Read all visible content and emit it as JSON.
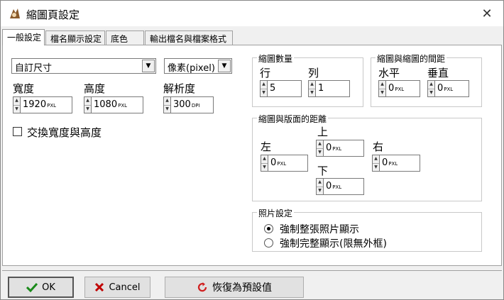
{
  "window": {
    "title": "縮圖頁設定",
    "close_label": "✕"
  },
  "tabs": [
    {
      "label": "一般設定",
      "active": true
    },
    {
      "label": "檔名顯示設定",
      "active": false
    },
    {
      "label": "底色",
      "active": false
    },
    {
      "label": "輸出檔名與檔案格式",
      "active": false
    }
  ],
  "size_preset": {
    "value": "自訂尺寸"
  },
  "unit_select": {
    "value": "像素(pixel)"
  },
  "width": {
    "label": "寬度",
    "value": "1920",
    "unit": "PXL"
  },
  "height": {
    "label": "高度",
    "value": "1080",
    "unit": "PXL"
  },
  "resolution": {
    "label": "解析度",
    "value": "300",
    "unit": "DPI"
  },
  "swap": {
    "label": "交換寬度與高度",
    "checked": false
  },
  "thumb_count": {
    "group_title": "縮圖數量",
    "rows": {
      "label": "行",
      "value": "5"
    },
    "cols": {
      "label": "列",
      "value": "1"
    }
  },
  "thumb_spacing": {
    "group_title": "縮圖與縮圖的間距",
    "horizontal": {
      "label": "水平",
      "value": "0",
      "unit": "PXL"
    },
    "vertical": {
      "label": "垂直",
      "value": "0",
      "unit": "PXL"
    }
  },
  "margin": {
    "group_title": "縮圖與版面的距離",
    "left": {
      "label": "左",
      "value": "0",
      "unit": "PXL"
    },
    "top": {
      "label": "上",
      "value": "0",
      "unit": "PXL"
    },
    "right": {
      "label": "右",
      "value": "0",
      "unit": "PXL"
    },
    "bottom": {
      "label": "下",
      "value": "0",
      "unit": "PXL"
    }
  },
  "photo": {
    "group_title": "照片設定",
    "options": [
      {
        "label": "強制整張照片顯示",
        "selected": true
      },
      {
        "label": "強制完整顯示(限無外框)",
        "selected": false
      }
    ]
  },
  "buttons": {
    "ok": "OK",
    "cancel": "Cancel",
    "reset": "恢復為預設值"
  },
  "colors": {
    "ok_check": "#1a8a1a",
    "cancel_x": "#c00000",
    "reset_icon": "#d02020"
  }
}
